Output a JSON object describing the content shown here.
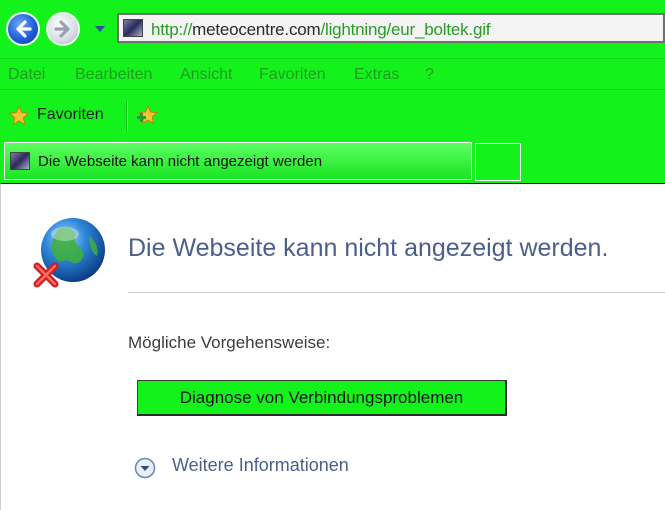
{
  "address_bar": {
    "url_prefix": "http://",
    "url_domain": "meteocentre.com",
    "url_path": "/lightning/eur_boltek.gif"
  },
  "menu": {
    "items": [
      "Datei",
      "Bearbeiten",
      "Ansicht",
      "Favoriten",
      "Extras",
      "?"
    ]
  },
  "favorites_bar": {
    "label": "Favoriten"
  },
  "tab": {
    "label": "Die Webseite kann nicht angezeigt werden"
  },
  "error_page": {
    "title": "Die Webseite kann nicht angezeigt werden.",
    "options_label": "Mögliche Vorgehensweise:",
    "diagnose_button": "Diagnose von Verbindungsproblemen",
    "more_info": "Weitere Informationen"
  },
  "colors": {
    "chrome_background": "#14f21c",
    "link_text": "#4a5f8c",
    "url_text": "#2a9a2a"
  },
  "icons": [
    "back-arrow-icon",
    "forward-arrow-icon",
    "history-dropdown-icon",
    "page-favicon-icon",
    "favorites-star-icon",
    "add-favorite-icon",
    "globe-error-icon",
    "expand-chevron-icon"
  ]
}
